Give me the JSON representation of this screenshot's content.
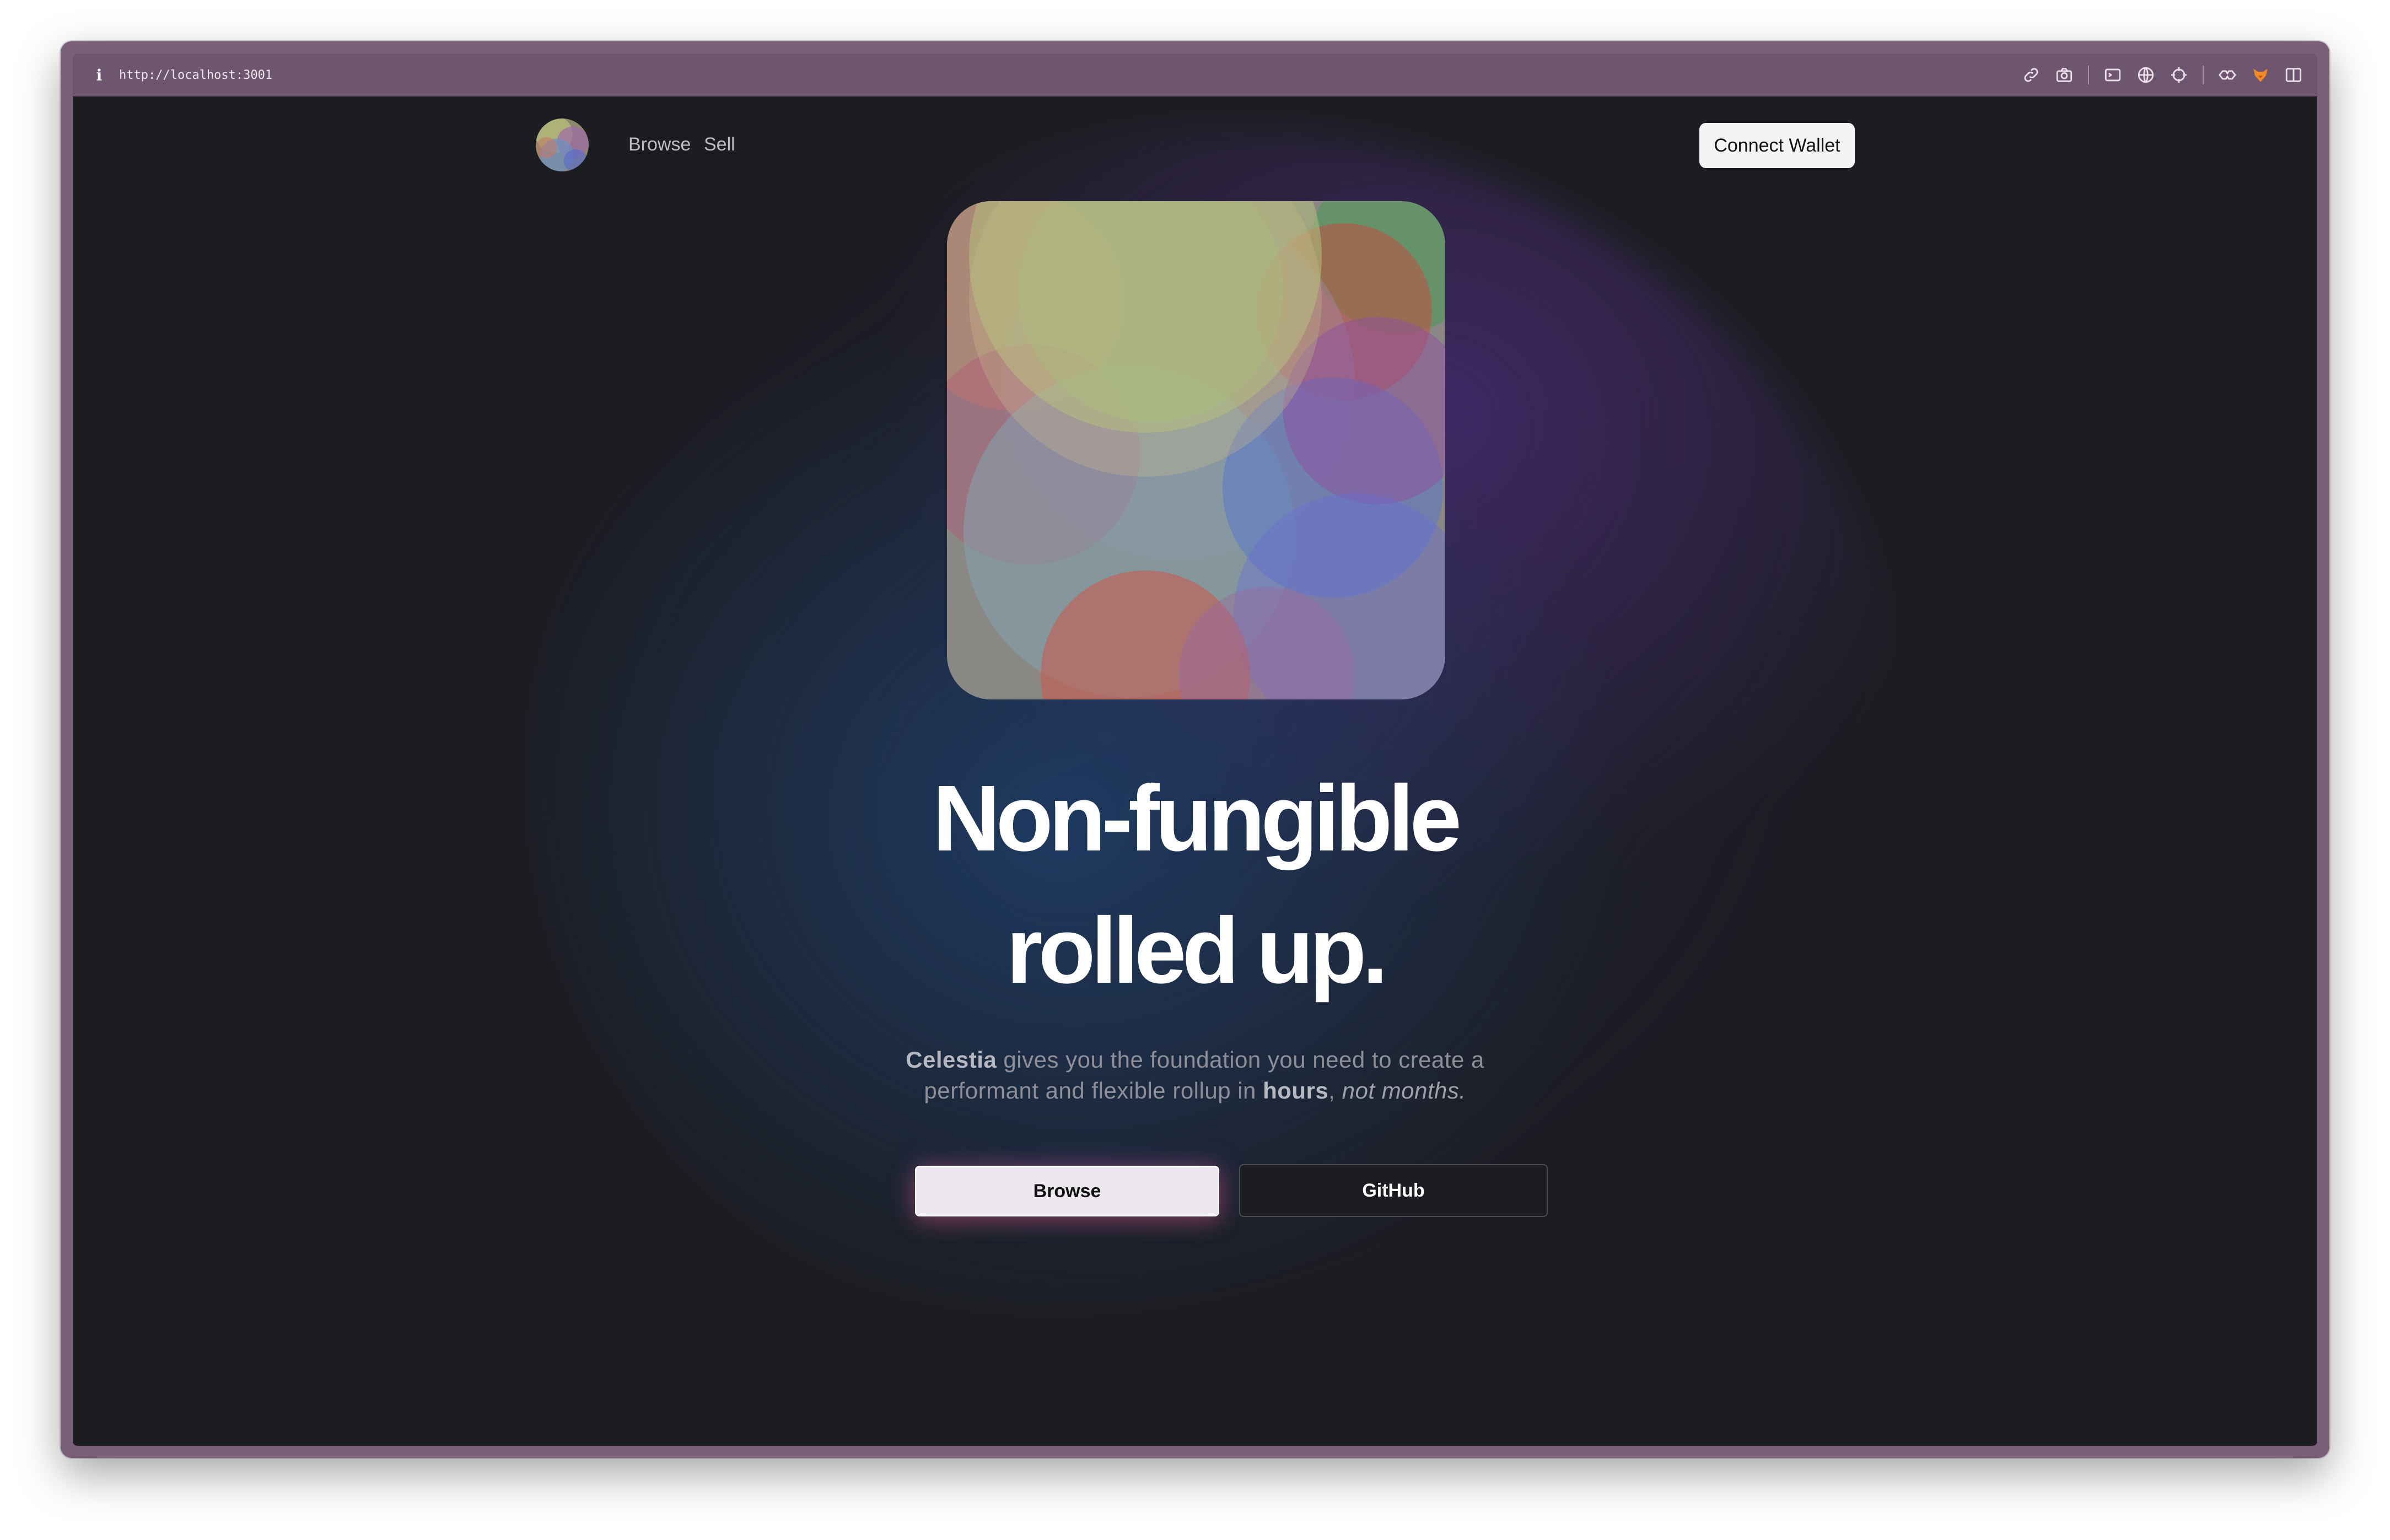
{
  "browser": {
    "url": "http://localhost:3001",
    "toolbar_icons": [
      "link-icon",
      "camera-icon",
      "terminal-icon",
      "globe-icon",
      "crosshair-icon",
      "extension-icon",
      "fox-icon",
      "sidebar-icon"
    ]
  },
  "nav": {
    "links": [
      "Browse",
      "Sell"
    ],
    "connect_wallet": "Connect Wallet"
  },
  "hero": {
    "headline_line1": "Non-fungible",
    "headline_line2": "rolled up.",
    "subtitle": {
      "brand": "Celestia",
      "text_1": " gives you the foundation you need to create a",
      "text_2": "performant and flexible rollup in ",
      "emphasis_bold": "hours",
      "comma": ", ",
      "emphasis_italic": "not months."
    },
    "primary_button": "Browse",
    "secondary_button": "GitHub"
  },
  "colors": {
    "window_frame": "#7a5f78",
    "page_background": "#1c1d21",
    "headline": "#ffffff",
    "subtitle": "#8e8f98"
  }
}
